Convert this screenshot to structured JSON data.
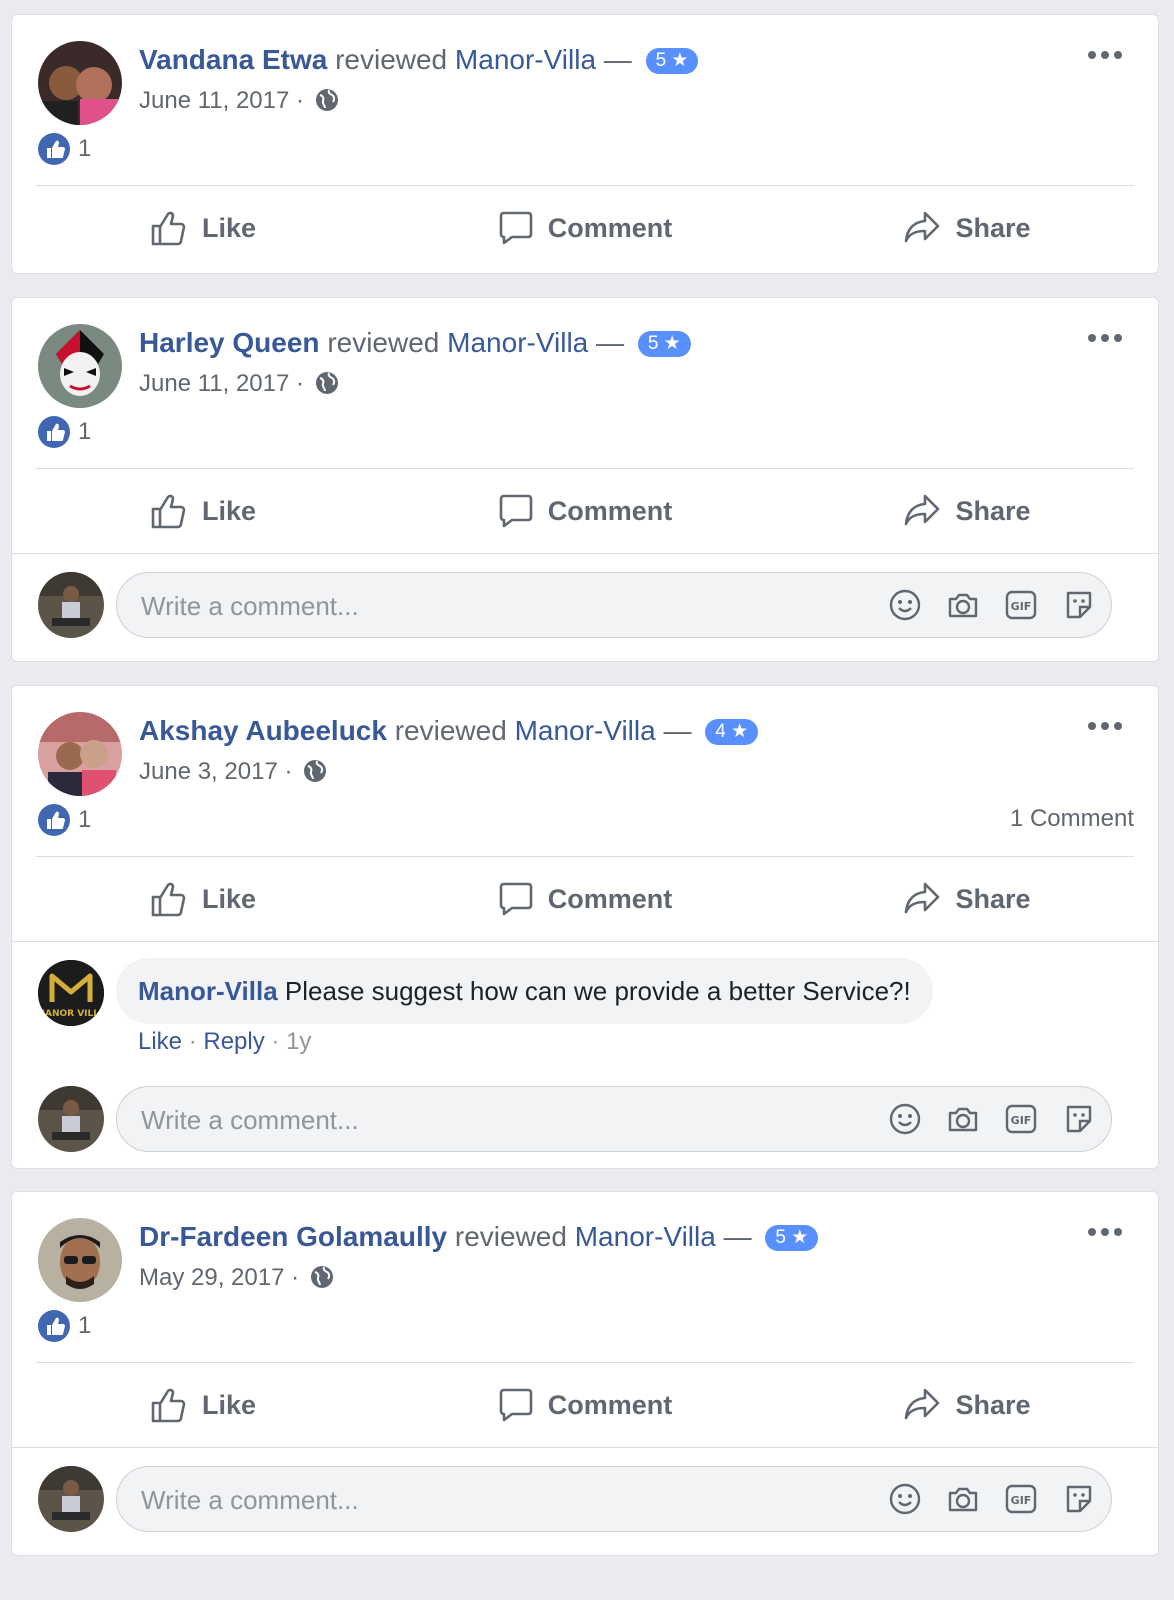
{
  "common": {
    "verb": "reviewed",
    "page_name": "Manor-Villa",
    "dash": "—",
    "separator": "·",
    "actions": {
      "like": "Like",
      "comment": "Comment",
      "share": "Share"
    },
    "comment_placeholder": "Write a comment..."
  },
  "reviews": [
    {
      "reviewer": "Vandana Etwa",
      "rating": "5 ★",
      "date": "June 11, 2017",
      "like_count": "1",
      "comment_count": ""
    },
    {
      "reviewer": "Harley Queen",
      "rating": "5 ★",
      "date": "June 11, 2017",
      "like_count": "1",
      "comment_count": ""
    },
    {
      "reviewer": "Akshay Aubeeluck",
      "rating": "4 ★",
      "date": "June 3, 2017",
      "like_count": "1",
      "comment_count": "1 Comment",
      "reply": {
        "author": "Manor-Villa",
        "text": "Please suggest how can we provide a better Service?!",
        "like": "Like",
        "reply": "Reply",
        "age": "1y",
        "avatar_text": "MANOR VILLA"
      }
    },
    {
      "reviewer": "Dr-Fardeen Golamaully",
      "rating": "5 ★",
      "date": "May 29, 2017",
      "like_count": "1",
      "comment_count": ""
    }
  ],
  "icons": {
    "more": "more-options-icon",
    "globe": "globe-icon",
    "like": "thumbs-up-icon",
    "comment": "speech-bubble-icon",
    "share": "share-arrow-icon",
    "emoji": "smiley-icon",
    "camera": "camera-icon",
    "gif": "gif-icon",
    "sticker": "sticker-icon"
  },
  "colors": {
    "link": "#385898",
    "accent": "#4267b2",
    "rating_badge": "#5890ff",
    "muted": "#606770"
  }
}
